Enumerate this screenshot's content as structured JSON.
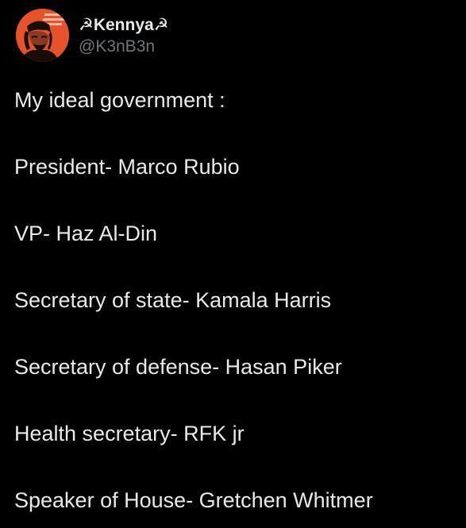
{
  "author": {
    "display_name": "☭Kennya☭",
    "handle": "@K3nB3n",
    "avatar_icon": "che-guevara-avatar-icon"
  },
  "tweet": {
    "lines": [
      "My ideal government :",
      "President- Marco Rubio",
      "VP- Haz Al-Din",
      "Secretary of state- Kamala Harris",
      "Secretary of defense- Hasan Piker",
      "Health secretary- RFK jr",
      "Speaker of House- Gretchen Whitmer"
    ]
  },
  "colors": {
    "background": "#000000",
    "text": "#e7e9ea",
    "secondary_text": "#71767b",
    "avatar_bg": "#e5532b"
  }
}
